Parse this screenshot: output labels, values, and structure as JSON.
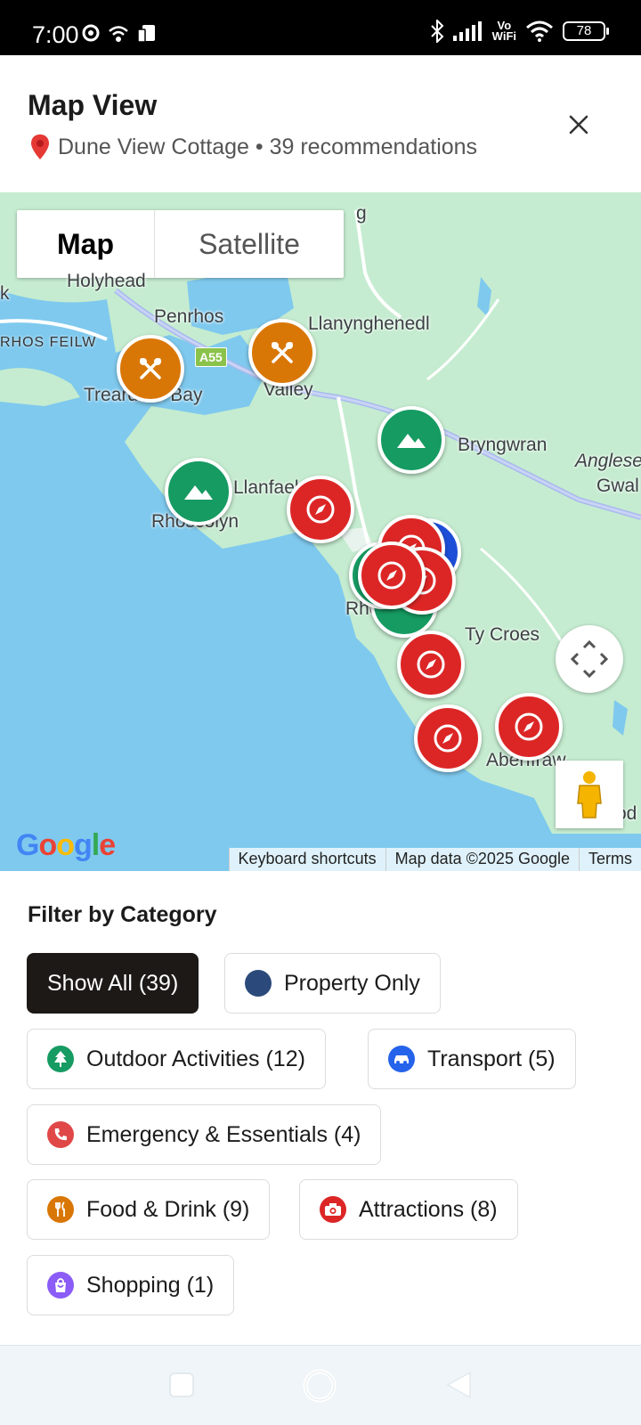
{
  "status_bar": {
    "time": "7:00",
    "vowifi_top": "Vo",
    "vowifi_bottom": "WiFi",
    "battery": "78"
  },
  "header": {
    "title": "Map View",
    "pin_icon": "map-pin-icon",
    "subtitle": "Dune View Cottage • 39 recommendations",
    "close_icon": "close-icon"
  },
  "map": {
    "toggle": {
      "map_label": "Map",
      "satellite_label": "Satellite",
      "selected": "Map"
    },
    "places": [
      "Holyhead",
      "Penrhos",
      "Llanynghenedl",
      "Valley",
      "Trearddur Bay",
      "Bryngwran",
      "Anglese",
      "Gwal",
      "Llanfaelog",
      "Rhoscolyn",
      "Rhosneigr",
      "Ty Croes",
      "Aberffraw",
      "Bod",
      "g"
    ],
    "road_label": "RHOS FEILW",
    "road_shield": "A55",
    "google_logo": "Google",
    "attribution": {
      "shortcuts": "Keyboard shortcuts",
      "data": "Map data ©2025 Google",
      "terms": "Terms"
    },
    "markers": [
      "food",
      "food",
      "outdoor",
      "outdoor",
      "attraction",
      "outdoor",
      "property",
      "attraction",
      "attraction",
      "attraction",
      "attraction",
      "attraction",
      "attraction"
    ],
    "colors": {
      "food": "#d97706",
      "outdoor": "#169b62",
      "attraction": "#dc2626",
      "property": "#1d4ed8",
      "water": "#7fc9ee",
      "land": "#c5ecd0"
    }
  },
  "filters": {
    "title": "Filter by Category",
    "chips": [
      {
        "label": "Show All (39)",
        "icon": "",
        "active": true
      },
      {
        "label": "Property Only",
        "icon": "navy-dot-icon",
        "active": false
      },
      {
        "label": "Outdoor Activities (12)",
        "icon": "tree-icon",
        "active": false
      },
      {
        "label": "Transport (5)",
        "icon": "car-icon",
        "active": false
      },
      {
        "label": "Emergency & Essentials (4)",
        "icon": "phone-icon",
        "active": false
      },
      {
        "label": "Food & Drink (9)",
        "icon": "utensils-icon",
        "active": false
      },
      {
        "label": "Attractions (8)",
        "icon": "camera-icon",
        "active": false
      },
      {
        "label": "Shopping (1)",
        "icon": "shopping-bag-icon",
        "active": false
      }
    ]
  }
}
